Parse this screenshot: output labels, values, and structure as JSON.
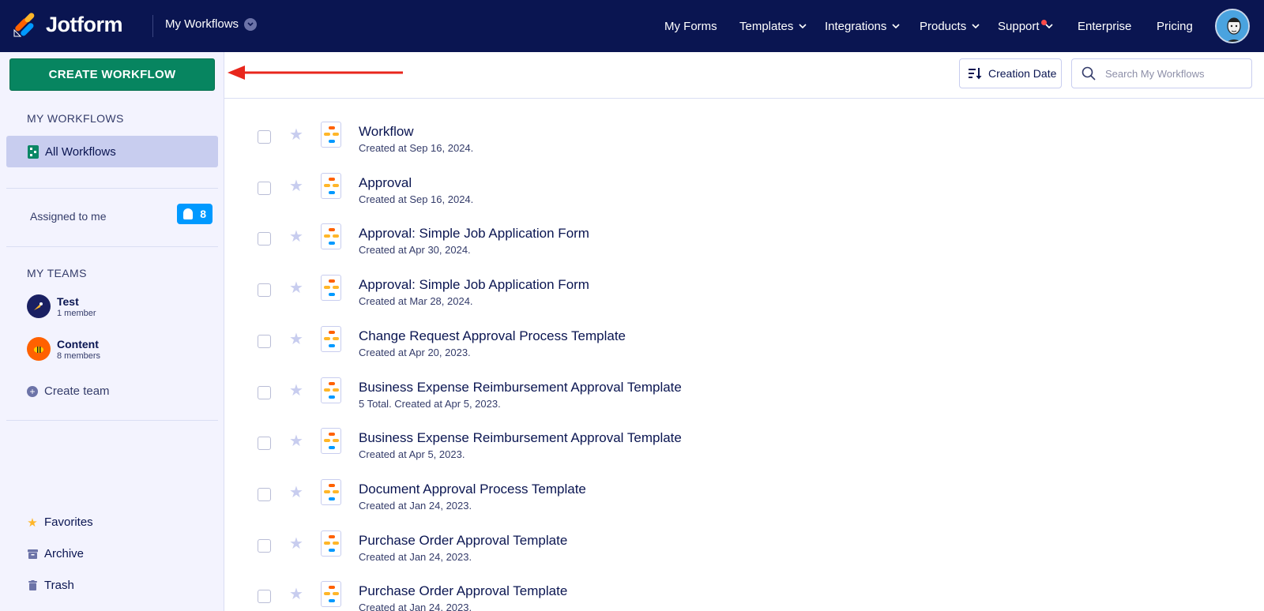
{
  "brand": {
    "name": "Jotform"
  },
  "workspace": {
    "label": "My Workflows"
  },
  "nav": {
    "items": [
      {
        "label": "My Forms"
      },
      {
        "label": "Templates"
      },
      {
        "label": "Integrations"
      },
      {
        "label": "Products"
      },
      {
        "label": "Support"
      },
      {
        "label": "Enterprise"
      },
      {
        "label": "Pricing"
      }
    ]
  },
  "sidebar": {
    "create_button": "CREATE WORKFLOW",
    "my_workflows_heading": "MY WORKFLOWS",
    "all_workflows": "All Workflows",
    "assigned_label": "Assigned to me",
    "assigned_count": "8",
    "teams_heading": "MY TEAMS",
    "teams": [
      {
        "name": "Test",
        "members": "1 member"
      },
      {
        "name": "Content",
        "members": "8 members"
      }
    ],
    "create_team": "Create team",
    "favorites": "Favorites",
    "archive": "Archive",
    "trash": "Trash"
  },
  "toolbar": {
    "sort_label": "Creation Date",
    "search_placeholder": "Search My Workflows"
  },
  "workflows": [
    {
      "title": "Workflow",
      "subtitle": "Created at Sep 16, 2024."
    },
    {
      "title": "Approval",
      "subtitle": "Created at Sep 16, 2024."
    },
    {
      "title": "Approval: Simple Job Application Form",
      "subtitle": "Created at Apr 30, 2024."
    },
    {
      "title": "Approval: Simple Job Application Form",
      "subtitle": "Created at Mar 28, 2024."
    },
    {
      "title": "Change Request Approval Process Template",
      "subtitle": "Created at Apr 20, 2023."
    },
    {
      "title": "Business Expense Reimbursement Approval Template",
      "subtitle": "5 Total. Created at Apr 5, 2023."
    },
    {
      "title": "Business Expense Reimbursement Approval Template",
      "subtitle": "Created at Apr 5, 2023."
    },
    {
      "title": "Document Approval Process Template",
      "subtitle": "Created at Jan 24, 2023."
    },
    {
      "title": "Purchase Order Approval Template",
      "subtitle": "Created at Jan 24, 2023."
    },
    {
      "title": "Purchase Order Approval Template",
      "subtitle": "Created at Jan 24, 2023."
    }
  ],
  "colors": {
    "navy": "#0a1551",
    "green": "#078560",
    "sidebar_bg": "#f3f3fe",
    "selected_bg": "#c8cdef",
    "badge_blue": "#0099ff",
    "arrow_red": "#e8261c"
  }
}
